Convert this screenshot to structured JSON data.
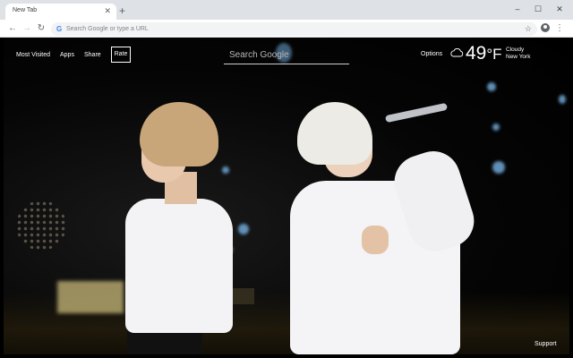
{
  "browser": {
    "tab_title": "New Tab",
    "tab_close_icon": "close-icon",
    "new_tab_icon": "plus-icon",
    "window_controls": [
      "minimize-icon",
      "maximize-icon",
      "close-icon"
    ],
    "omnibox_placeholder": "Search Google or type a URL",
    "omnibox_value": ""
  },
  "nav": {
    "most_visited": "Most Visited",
    "apps": "Apps",
    "share": "Share",
    "rate": "Rate"
  },
  "search": {
    "placeholder": "Search Google",
    "value": ""
  },
  "weather": {
    "options_label": "Options",
    "icon": "cloud-icon",
    "temperature": "49",
    "unit": "°F",
    "condition": "Cloudy",
    "city": "New York"
  },
  "footer": {
    "support": "Support"
  }
}
